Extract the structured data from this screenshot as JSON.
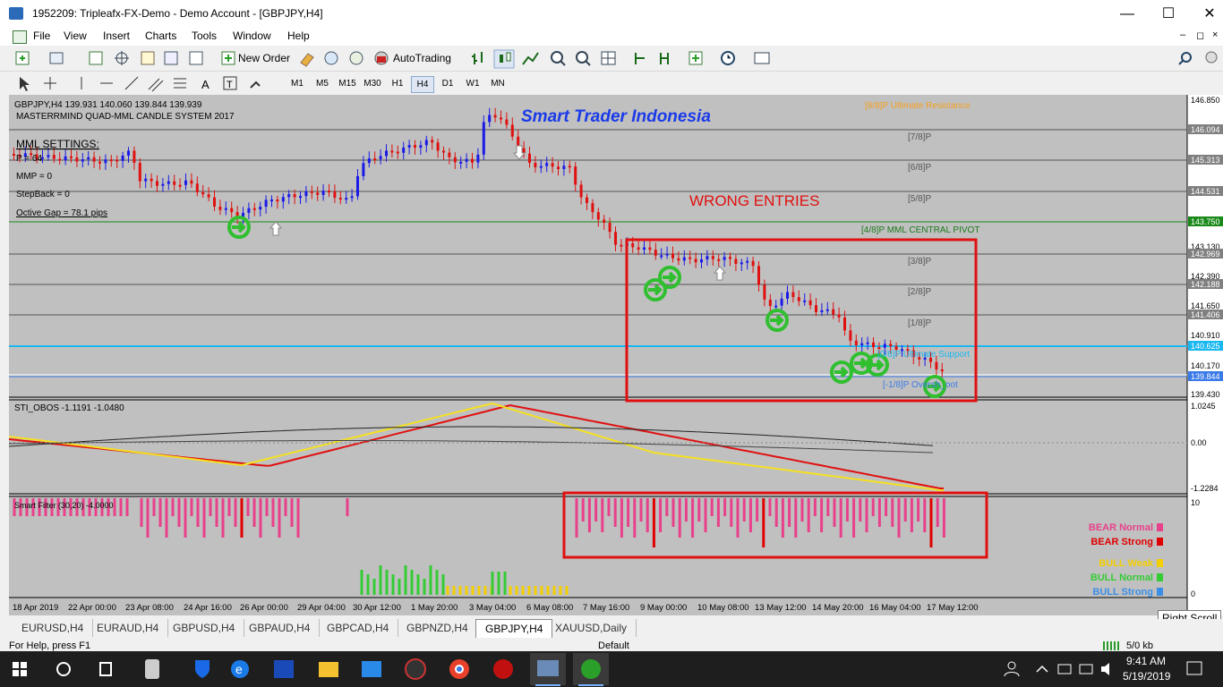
{
  "window": {
    "title": "1952209: Tripleafx-FX-Demo - Demo Account - [GBPJPY,H4]"
  },
  "menu": [
    "File",
    "View",
    "Insert",
    "Charts",
    "Tools",
    "Window",
    "Help"
  ],
  "toolbar": {
    "new_order": "New Order",
    "autotrading": "AutoTrading"
  },
  "timeframes": [
    "M1",
    "M5",
    "M15",
    "M30",
    "H1",
    "H4",
    "D1",
    "W1",
    "MN"
  ],
  "active_timeframe": "H4",
  "chart": {
    "symbol_line": "GBPJPY,H4  139.931 140.060 139.844 139.939",
    "system_name": "MASTERRMIND QUAD-MML CANDLE SYSTEM 2017",
    "brand": "Smart Trader Indonesia",
    "annotation": "WRONG ENTRIES",
    "settings_title": "MML SETTINGS:",
    "settings": [
      "P = 64",
      "MMP = 0",
      "StepBack = 0",
      "Octive Gap = 78.1 pips"
    ],
    "mml_labels": {
      "ultimate_resistance": "[8/8]P Ultimate Resistance",
      "l78": "[7/8]P",
      "l68": "[6/8]P",
      "l58": "[5/8]P",
      "central": "[4/8]P MML CENTRAL PIVOT",
      "l38": "[3/8]P",
      "l28": "[2/8]P",
      "l18": "[1/8]P",
      "ultimate_support": "[0/8]P Ultimate Support",
      "oversh": "[-1/8]P Oversh_oot"
    },
    "price_ticks": [
      "146.850",
      "146.094",
      "145.313",
      "144.531",
      "143.750",
      "143.130",
      "142.969",
      "142.390",
      "142.188",
      "141.650",
      "141.406",
      "140.910",
      "140.625",
      "140.170",
      "139.844",
      "139.430"
    ],
    "date_labels": [
      "18 Apr 2019",
      "22 Apr 00:00",
      "23 Apr 08:00",
      "24 Apr 16:00",
      "26 Apr 00:00",
      "29 Apr 04:00",
      "30 Apr 12:00",
      "1 May 20:00",
      "3 May 04:00",
      "6 May 08:00",
      "7 May 16:00",
      "9 May 00:00",
      "10 May 08:00",
      "13 May 12:00",
      "14 May 20:00",
      "16 May 04:00",
      "17 May 12:00"
    ],
    "sti_label": "STI_OBOS -1.1191 -1.0480",
    "sti_ticks": [
      "1.0245",
      "0.00",
      "-1.2284"
    ],
    "filter_label": "Smart Filter (30,20) -4.0000",
    "filter_ticks": [
      "10",
      "0"
    ],
    "legend": [
      {
        "text": "BEAR Normal",
        "color": "#e8408a"
      },
      {
        "text": "BEAR Strong",
        "color": "#e00000"
      },
      {
        "text": "BULL Weak",
        "color": "#f5d000"
      },
      {
        "text": "BULL Normal",
        "color": "#33cc33"
      },
      {
        "text": "BULL Strong",
        "color": "#3a8ee6"
      }
    ]
  },
  "tabs": [
    "EURUSD,H4",
    "EURAUD,H4",
    "GBPUSD,H4",
    "GBPAUD,H4",
    "GBPCAD,H4",
    "GBPNZD,H4",
    "GBPJPY,H4",
    "XAUUSD,Daily"
  ],
  "active_tab": "GBPJPY,H4",
  "tooltip": "Right Scroll",
  "status": {
    "help": "For Help, press F1",
    "profile": "Default",
    "traffic": "5/0 kb"
  },
  "taskbar": {
    "time": "9:41 AM",
    "date": "5/19/2019"
  }
}
